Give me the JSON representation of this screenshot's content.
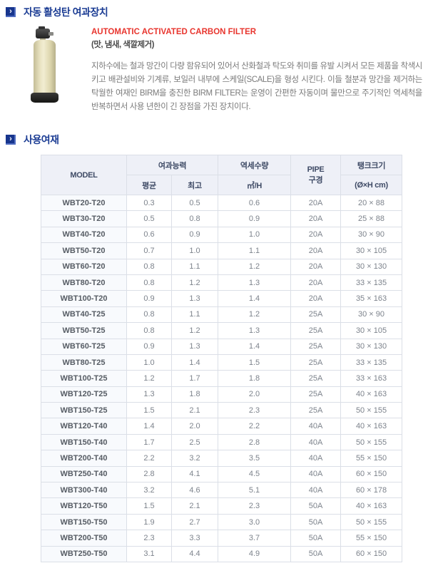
{
  "sections": {
    "title1": "자동 활성탄 여과장치",
    "title2": "사용여재",
    "bullet_glyph": "›"
  },
  "product": {
    "name_en": "AUTOMATIC ACTIVATED CARBON FILTER",
    "name_sub": "(맛, 냄새, 색깔제거)",
    "description": "지하수에는 철과 망간이 다량 함유되어 있어서 산화철과 탁도와 취미를 유발 시켜서 모든 제품을 착색시키고 배관설비와 기계류, 보일러 내부에 스케일(SCALE)을 형성 시킨다. 이들 철분과 망간을 제거하는 탁월한 여재인 BIRM을 충진한 BIRM FILTER는 운영이 간편한 자동이며 물만으로 주기적인 역세척을 반복하면서 사용 년한이 긴 장점을 가진 장치이다."
  },
  "colors": {
    "section_title_blue": "#1c3d94",
    "product_title_red": "#e8352e",
    "table_header_bg": "#eef0f7",
    "table_border": "#dbdfe7",
    "model_col_bg": "#f8fafd"
  },
  "table": {
    "headers": {
      "model": "MODEL",
      "capacity_group": "여과능력",
      "capacity_avg": "평균",
      "capacity_max": "최고",
      "backwash_group": "역세수량",
      "backwash_unit": "㎥/H",
      "pipe_line1": "PIPE",
      "pipe_line2": "구경",
      "tank_group": "탱크크기",
      "tank_unit": "(Ø×H cm)"
    },
    "rows": [
      [
        "WBT20-T20",
        "0.3",
        "0.5",
        "0.6",
        "20A",
        "20 × 88"
      ],
      [
        "WBT30-T20",
        "0.5",
        "0.8",
        "0.9",
        "20A",
        "25 × 88"
      ],
      [
        "WBT40-T20",
        "0.6",
        "0.9",
        "1.0",
        "20A",
        "30 × 90"
      ],
      [
        "WBT50-T20",
        "0.7",
        "1.0",
        "1.1",
        "20A",
        "30 × 105"
      ],
      [
        "WBT60-T20",
        "0.8",
        "1.1",
        "1.2",
        "20A",
        "30 × 130"
      ],
      [
        "WBT80-T20",
        "0.8",
        "1.2",
        "1.3",
        "20A",
        "33 × 135"
      ],
      [
        "WBT100-T20",
        "0.9",
        "1.3",
        "1.4",
        "20A",
        "35 × 163"
      ],
      [
        "WBT40-T25",
        "0.8",
        "1.1",
        "1.2",
        "25A",
        "30 × 90"
      ],
      [
        "WBT50-T25",
        "0.8",
        "1.2",
        "1.3",
        "25A",
        "30 × 105"
      ],
      [
        "WBT60-T25",
        "0.9",
        "1.3",
        "1.4",
        "25A",
        "30 × 130"
      ],
      [
        "WBT80-T25",
        "1.0",
        "1.4",
        "1.5",
        "25A",
        "33 × 135"
      ],
      [
        "WBT100-T25",
        "1.2",
        "1.7",
        "1.8",
        "25A",
        "33 × 163"
      ],
      [
        "WBT120-T25",
        "1.3",
        "1.8",
        "2.0",
        "25A",
        "40 × 163"
      ],
      [
        "WBT150-T25",
        "1.5",
        "2.1",
        "2.3",
        "25A",
        "50 × 155"
      ],
      [
        "WBT120-T40",
        "1.4",
        "2.0",
        "2.2",
        "40A",
        "40 × 163"
      ],
      [
        "WBT150-T40",
        "1.7",
        "2.5",
        "2.8",
        "40A",
        "50 × 155"
      ],
      [
        "WBT200-T40",
        "2.2",
        "3.2",
        "3.5",
        "40A",
        "55 × 150"
      ],
      [
        "WBT250-T40",
        "2.8",
        "4.1",
        "4.5",
        "40A",
        "60 × 150"
      ],
      [
        "WBT300-T40",
        "3.2",
        "4.6",
        "5.1",
        "40A",
        "60 × 178"
      ],
      [
        "WBT120-T50",
        "1.5",
        "2.1",
        "2.3",
        "50A",
        "40 × 163"
      ],
      [
        "WBT150-T50",
        "1.9",
        "2.7",
        "3.0",
        "50A",
        "50 × 155"
      ],
      [
        "WBT200-T50",
        "2.3",
        "3.3",
        "3.7",
        "50A",
        "55 × 150"
      ],
      [
        "WBT250-T50",
        "3.1",
        "4.4",
        "4.9",
        "50A",
        "60 × 150"
      ]
    ]
  }
}
